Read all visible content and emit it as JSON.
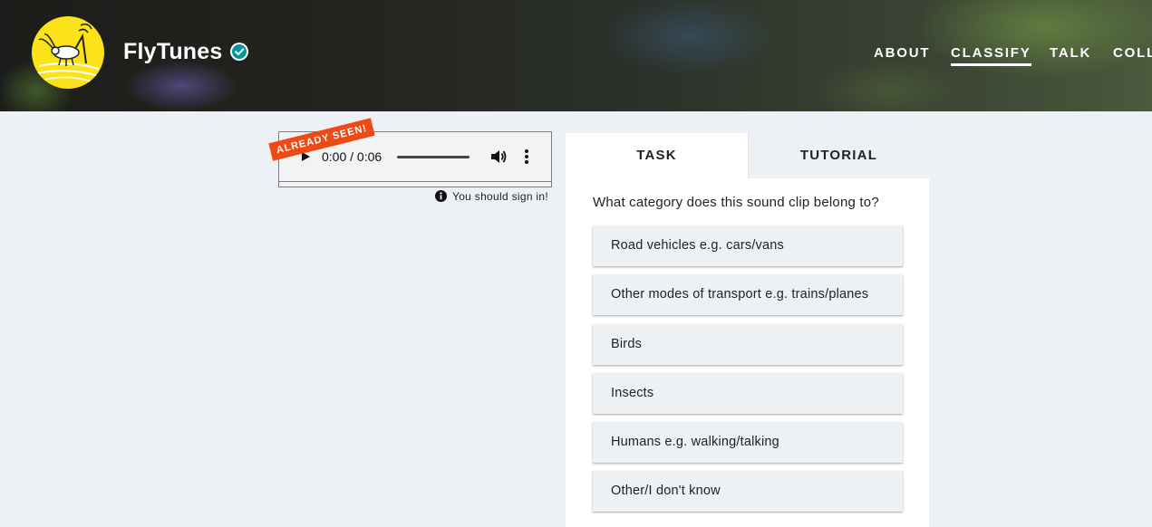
{
  "header": {
    "project_name": "FlyTunes",
    "nav": [
      {
        "label": "ABOUT",
        "active": false
      },
      {
        "label": "CLASSIFY",
        "active": true
      },
      {
        "label": "TALK",
        "active": false
      },
      {
        "label": "COLLI",
        "active": false
      }
    ]
  },
  "viewer": {
    "ribbon_label": "ALREADY SEEN!",
    "player": {
      "time": "0:00 / 0:06",
      "progress": 0
    },
    "signin_notice": "You should sign in!"
  },
  "task_panel": {
    "tabs": [
      {
        "label": "TASK",
        "active": true
      },
      {
        "label": "TUTORIAL",
        "active": false
      }
    ],
    "question": "What category does this sound clip belong to?",
    "answers": [
      "Road vehicles e.g. cars/vans",
      "Other modes of transport e.g. trains/planes",
      "Birds",
      "Insects",
      "Humans e.g. walking/talking",
      "Other/I don't know"
    ]
  },
  "colors": {
    "logo_yellow": "#fbe219",
    "ribbon_orange": "#ef4a16",
    "verified_teal": "#00979d",
    "page_background": "#edf1f5"
  },
  "icons": {
    "logo": "cricket-logo-icon",
    "verified": "verified-check-icon",
    "play": "play-icon",
    "volume": "volume-icon",
    "more": "more-vertical-icon",
    "info": "info-icon"
  }
}
